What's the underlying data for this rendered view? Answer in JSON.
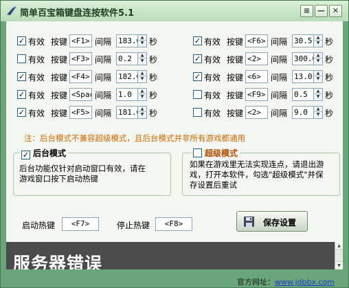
{
  "window": {
    "title": "简单百宝箱键盘连按软件5.1",
    "controls": {
      "menu": "≡",
      "minimize": "—",
      "close": "✕"
    }
  },
  "labels": {
    "valid": "有效",
    "key": "按键",
    "interval": "间隔",
    "seconds": "秒"
  },
  "left_rows": [
    {
      "checked": true,
      "key": "<F1>",
      "interval": "183.0"
    },
    {
      "checked": false,
      "key": "<F3>",
      "interval": "0.2"
    },
    {
      "checked": true,
      "key": "<F4>",
      "interval": "182.0"
    },
    {
      "checked": true,
      "key": "<Spac",
      "interval": "1.0"
    },
    {
      "checked": true,
      "key": "<F5>",
      "interval": "181.0"
    }
  ],
  "right_rows": [
    {
      "checked": true,
      "key": "<F6>",
      "interval": "30.5"
    },
    {
      "checked": true,
      "key": "<2>",
      "interval": "300.0"
    },
    {
      "checked": true,
      "key": "<6>",
      "interval": "13.0"
    },
    {
      "checked": false,
      "key": "<F9>",
      "interval": "0.5"
    },
    {
      "checked": false,
      "key": "<2>",
      "interval": "9.0"
    }
  ],
  "note": "注：后台模式不兼容超级模式，且后台模式并非所有游戏都通用",
  "background_mode": {
    "checked": true,
    "title": "后台模式",
    "desc_line1": "后台功能仅针对启动窗口有效，请在",
    "desc_line2": "游戏窗口按下启动热键"
  },
  "super_mode": {
    "checked": false,
    "title": "超级模式",
    "desc_line1": "如果在游戏里无法实现连点，请退出游",
    "desc_line2": "戏，打开本软件，勾选\"超级模式\"并保",
    "desc_line3": "存设置后重试"
  },
  "hotkeys": {
    "start_label": "启动热键",
    "start_value": "<F7>",
    "stop_label": "停止热键",
    "stop_value": "<F8>"
  },
  "save_button": {
    "label": "保存设置"
  },
  "banner": {
    "text": "服务器错误"
  },
  "footer": {
    "prefix": "官方网址：",
    "url": "www.jdbbx.com"
  },
  "colors": {
    "accent_green": "#6aa67a",
    "note_orange": "#d06a00",
    "group_title_orange": "#b34a00",
    "banner_bg": "#4b4b4b"
  }
}
